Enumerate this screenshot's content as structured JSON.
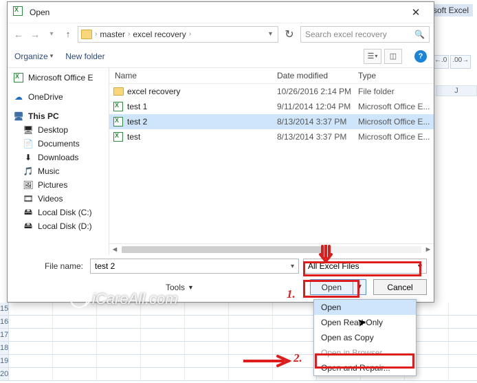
{
  "excel_hint": {
    "app_title": "Microsoft Excel",
    "dec_btn1": "←.0",
    "dec_btn2": ".00→",
    "col_letter": "J",
    "visible_rows": [
      "15",
      "16",
      "17",
      "18",
      "19",
      "20"
    ]
  },
  "dialog": {
    "title": "Open",
    "close_glyph": "✕",
    "nav": {
      "back": "←",
      "fwd": "→",
      "up": "↑",
      "refresh": "↻",
      "crumbs": [
        "master",
        "excel recovery"
      ],
      "sep": "›",
      "dropdown_caret": "▾",
      "search_placeholder": "Search excel recovery",
      "search_icon": "🔍"
    },
    "toolbar": {
      "organize": "Organize",
      "new_folder": "New folder",
      "view_caret": "▾",
      "help_glyph": "?"
    },
    "tree": {
      "office": "Microsoft Office E",
      "onedrive": "OneDrive",
      "this_pc": "This PC",
      "children": [
        {
          "icon": "🖥",
          "label": "Desktop"
        },
        {
          "icon": "📄",
          "label": "Documents"
        },
        {
          "icon": "⬇",
          "label": "Downloads"
        },
        {
          "icon": "🎵",
          "label": "Music"
        },
        {
          "icon": "🖼",
          "label": "Pictures"
        },
        {
          "icon": "🎞",
          "label": "Videos"
        },
        {
          "icon": "🖴",
          "label": "Local Disk (C:)"
        },
        {
          "icon": "🖴",
          "label": "Local Disk (D:)"
        }
      ]
    },
    "list": {
      "headers": {
        "name": "Name",
        "date": "Date modified",
        "type": "Type"
      },
      "rows": [
        {
          "kind": "folder",
          "name": "excel recovery",
          "date": "10/26/2016 2:14 PM",
          "type": "File folder",
          "selected": false
        },
        {
          "kind": "xls",
          "name": "test 1",
          "date": "9/11/2014 12:04 PM",
          "type": "Microsoft Office E...",
          "selected": false
        },
        {
          "kind": "xls",
          "name": "test 2",
          "date": "8/13/2014 3:37 PM",
          "type": "Microsoft Office E...",
          "selected": true
        },
        {
          "kind": "xls",
          "name": "test",
          "date": "8/13/2014 3:37 PM",
          "type": "Microsoft Office E...",
          "selected": false
        }
      ]
    },
    "footer": {
      "filename_label": "File name:",
      "filename_value": "test 2",
      "type_filter": "All Excel Files",
      "tools": "Tools",
      "open_btn": "Open",
      "open_caret": "▼",
      "cancel_btn": "Cancel"
    }
  },
  "menu": {
    "items": [
      {
        "label": "Open",
        "state": "highlight"
      },
      {
        "label": "Open Read-Only",
        "state": ""
      },
      {
        "label": "Open as Copy",
        "state": ""
      },
      {
        "label": "Open in Browser",
        "state": "disabled"
      },
      {
        "label": "Open and Repair...",
        "state": ""
      }
    ]
  },
  "annotations": {
    "step1": "1.",
    "step2": "2."
  },
  "watermark": "iCareAll.com"
}
